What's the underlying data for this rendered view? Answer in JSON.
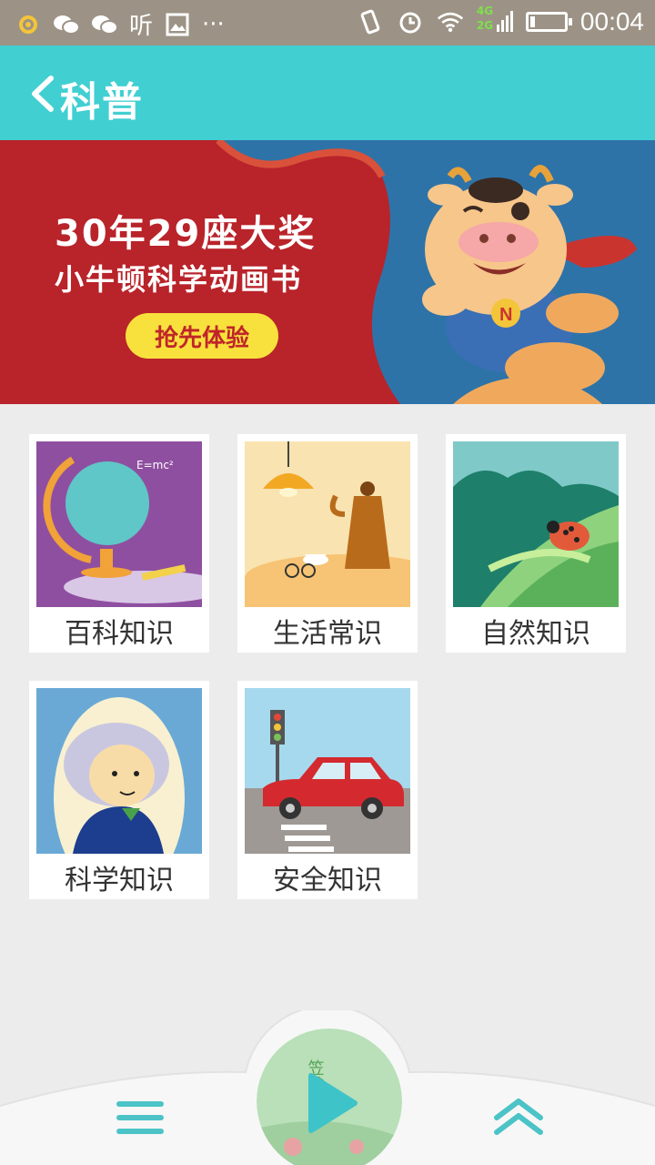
{
  "status_bar": {
    "left_text": "听",
    "more": "···",
    "net_top": "4G",
    "net_bottom": "2G",
    "time": "00:04"
  },
  "header": {
    "title": "科普"
  },
  "banner": {
    "line1": "30年29座大奖",
    "line2": "小牛顿科学动画书",
    "button": "抢先体验",
    "mascot_letter": "N"
  },
  "categories": [
    {
      "label": "百科知识",
      "icon": "globe-icon"
    },
    {
      "label": "生活常识",
      "icon": "coffee-icon"
    },
    {
      "label": "自然知识",
      "icon": "ladybug-icon"
    },
    {
      "label": "科学知识",
      "icon": "scientist-icon"
    },
    {
      "label": "安全知识",
      "icon": "car-icon"
    }
  ],
  "player": {
    "cover_text": "笠翁对"
  },
  "colors": {
    "accent": "#41cfd2",
    "banner_red": "#b9232a",
    "banner_blue": "#2e73a8",
    "button_yellow": "#f8e13c"
  }
}
